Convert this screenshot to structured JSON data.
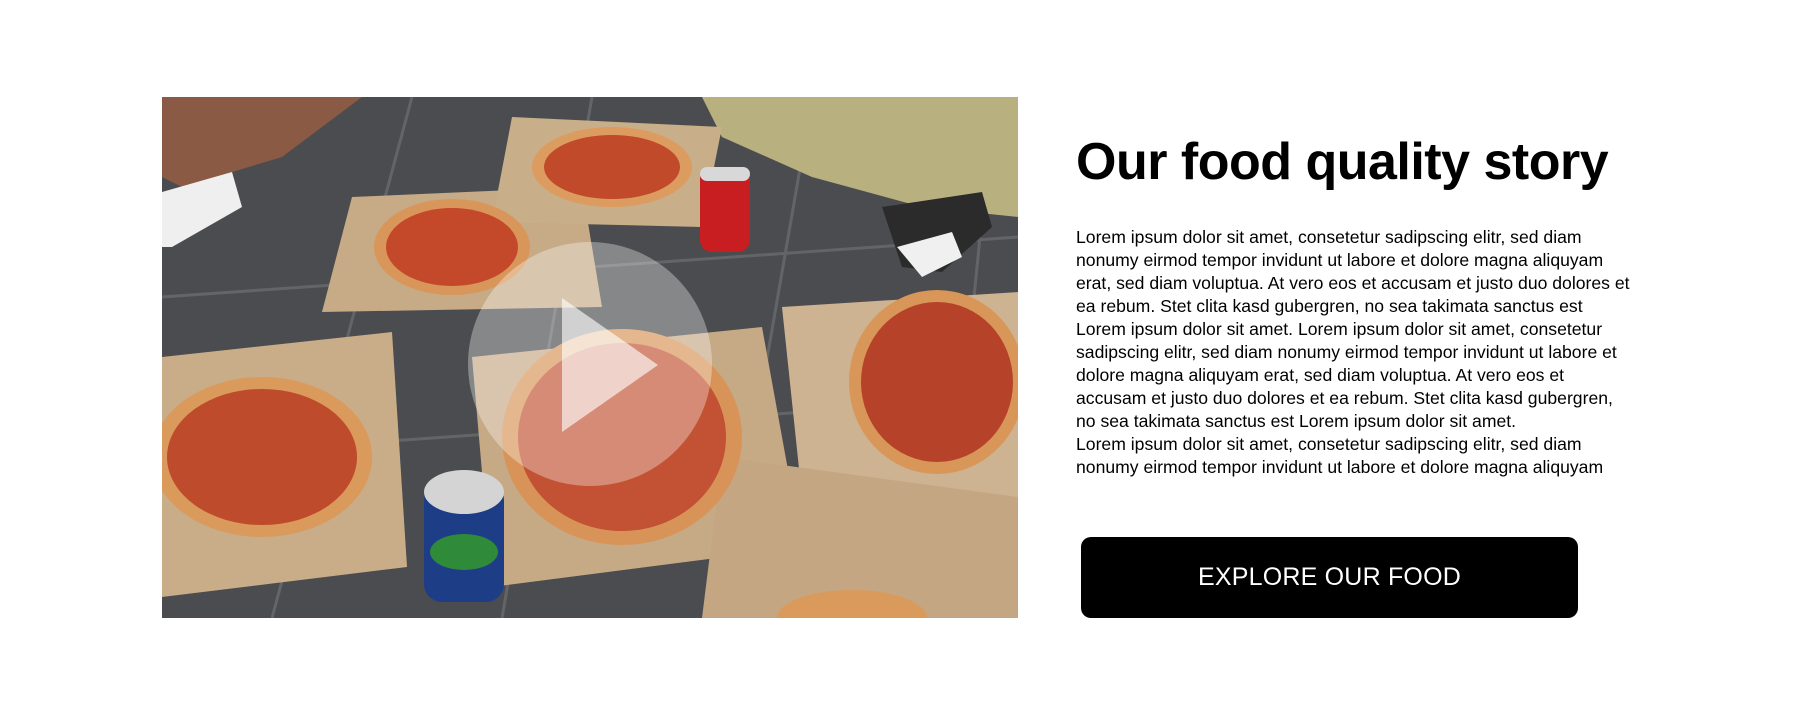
{
  "media": {
    "play_icon": "play-icon",
    "overlay_color": "#ffffff"
  },
  "content": {
    "title": "Our food quality story",
    "body_lines": [
      "Lorem ipsum dolor sit amet, consetetur sadipscing elitr, sed diam",
      "nonumy eirmod tempor invidunt ut labore et dolore magna aliquyam",
      "erat, sed diam voluptua. At vero eos et accusam et justo duo dolores et",
      "ea rebum. Stet clita kasd gubergren, no sea takimata sanctus est",
      "Lorem ipsum dolor sit amet. Lorem ipsum dolor sit amet, consetetur",
      "sadipscing elitr, sed diam nonumy eirmod tempor invidunt ut labore et",
      "dolore magna aliquyam erat, sed diam voluptua. At vero eos et",
      "accusam et justo duo dolores et ea rebum. Stet clita kasd gubergren,",
      "no sea takimata sanctus est Lorem ipsum dolor sit amet.",
      "Lorem ipsum dolor sit amet, consetetur sadipscing elitr, sed diam",
      "nonumy eirmod tempor invidunt ut labore et dolore magna aliquyam"
    ],
    "cta_label": "EXPLORE OUR FOOD"
  },
  "colors": {
    "background": "#ffffff",
    "text": "#000000",
    "button_background": "#000000",
    "button_text": "#ffffff"
  }
}
